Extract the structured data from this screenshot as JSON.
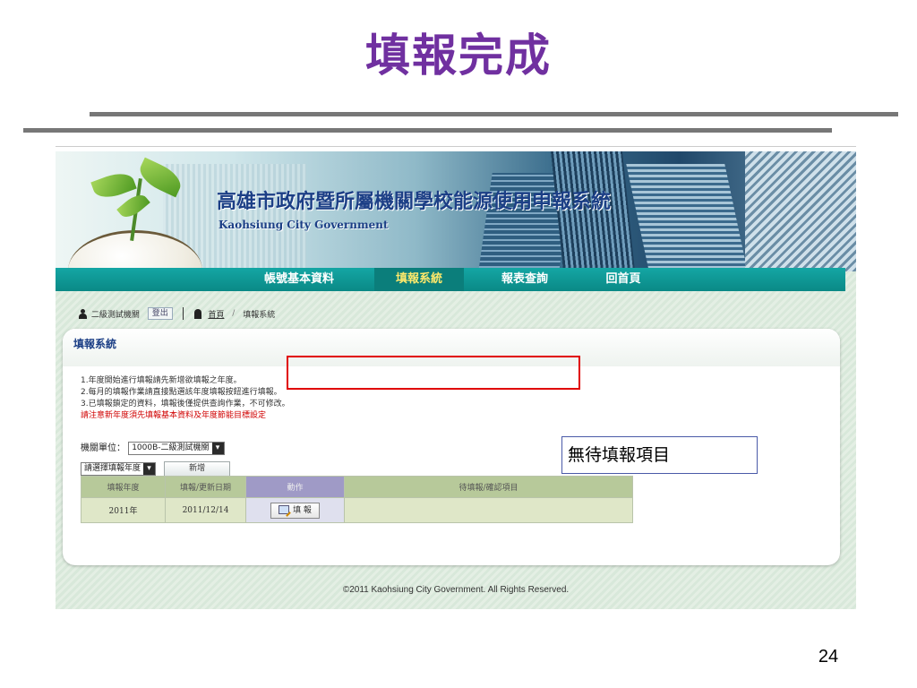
{
  "slide": {
    "title": "填報完成",
    "page_number": "24",
    "callout": "無待填報項目"
  },
  "site": {
    "title": "高雄市政府暨所屬機關學校能源使用申報系統",
    "subtitle": "Kaohsiung City Government",
    "nav": [
      {
        "label": "帳號基本資料"
      },
      {
        "label": "填報系統"
      },
      {
        "label": "報表查詢"
      },
      {
        "label": "回首頁"
      }
    ],
    "active_nav": "填報系統",
    "accent_color": "#0a8986"
  },
  "breadcrumb": {
    "user": "二級測試機關",
    "logout": "登出",
    "home": "首頁",
    "slash": "/",
    "current": "填報系統"
  },
  "panel": {
    "title": "填報系統",
    "notes": [
      "1.年度開始進行填報請先新增欲填報之年度。",
      "2.每月的填報作業請直接點選該年度填報按鈕進行填報。",
      "3.已填報鎖定的資料，填報後僅提供查詢作業，不可修改。"
    ],
    "red_note": "請注意新年度須先填報基本資料及年度節能目標設定",
    "unit_label": "機關單位：",
    "unit_value": "1000B-二級測試機關",
    "year_select": "請選擇填報年度",
    "add_button": "新增"
  },
  "table": {
    "headers": [
      "填報年度",
      "填報/更新日期",
      "動作",
      "待填報/確認項目"
    ],
    "rows": [
      {
        "year": "2011年",
        "date": "2011/12/14",
        "action": "填 報",
        "pending": ""
      }
    ]
  },
  "footer": {
    "copyright": "©2011 Kaohsiung City Government. All Rights Reserved."
  }
}
